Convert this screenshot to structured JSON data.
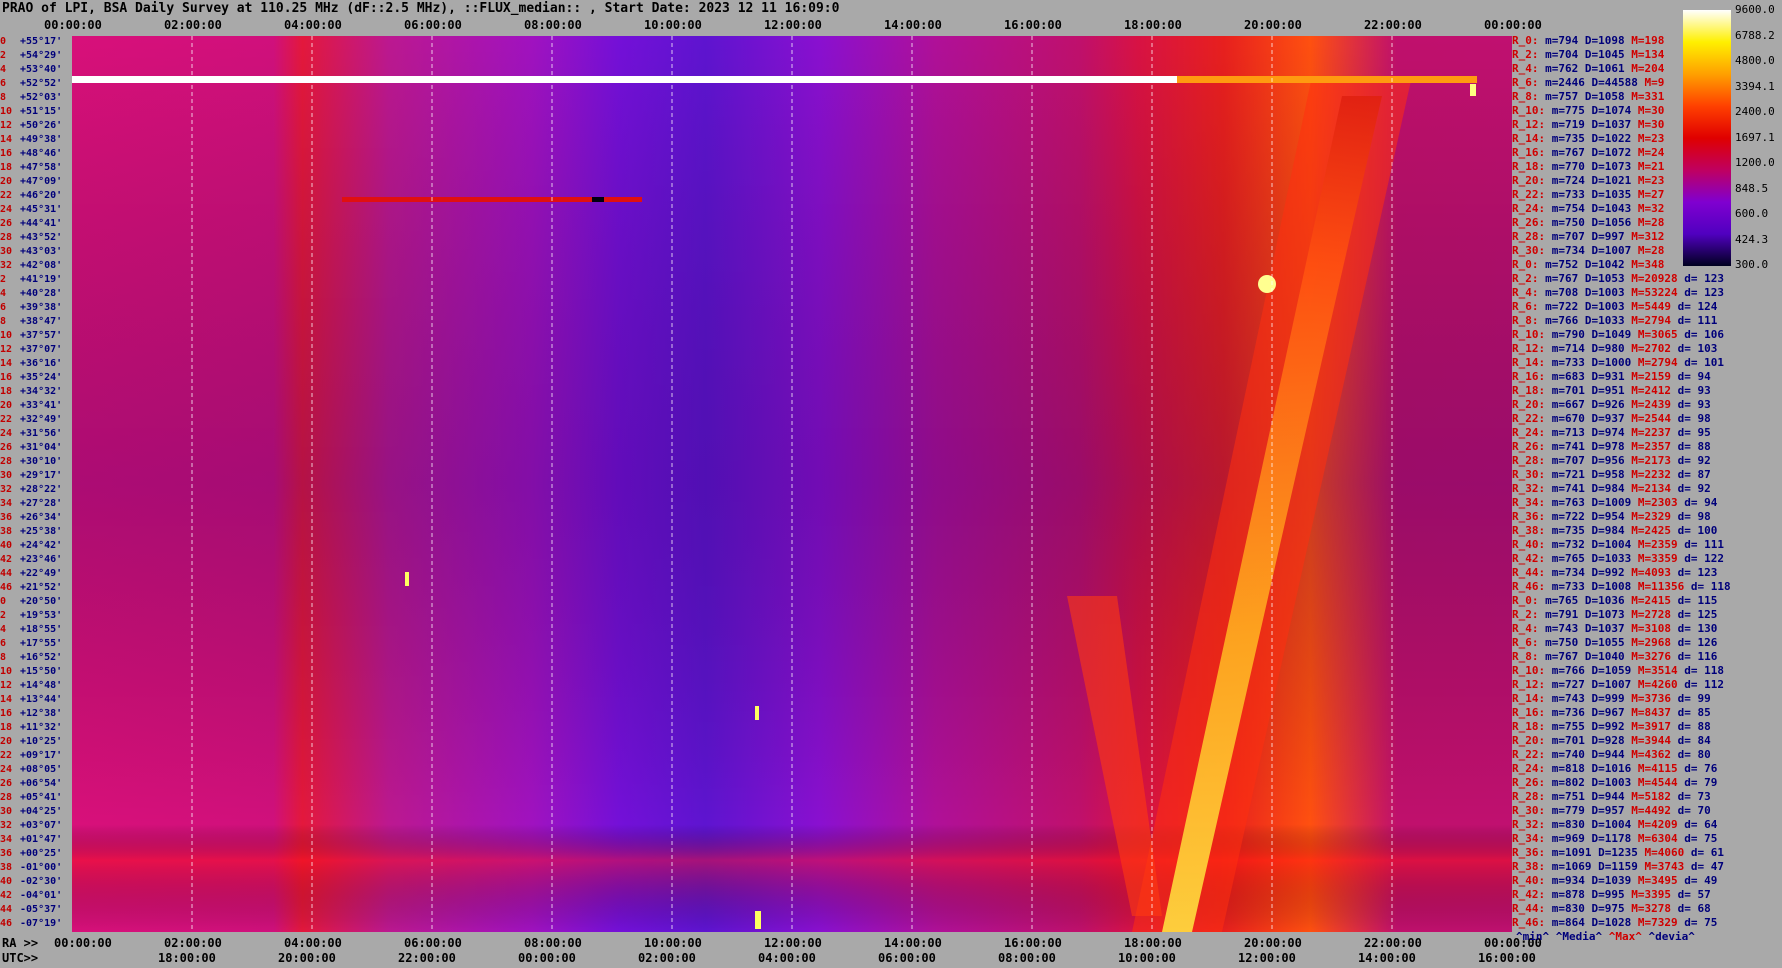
{
  "title": "PRAO of LPI, BSA Daily Survey at 110.25 MHz (dF::2.5 MHz), ::FLUX_median:: , Start Date: 2023 12 11 16:09:0",
  "top_axis_labels": [
    "00:00:00",
    "02:00:00",
    "04:00:00",
    "06:00:00",
    "08:00:00",
    "10:00:00",
    "12:00:00",
    "14:00:00",
    "16:00:00",
    "18:00:00",
    "20:00:00",
    "22:00:00",
    "00:00:00"
  ],
  "bottom_ra_prefix": "RA >>",
  "bottom_ra_labels": [
    "00:00:00",
    "02:00:00",
    "04:00:00",
    "06:00:00",
    "08:00:00",
    "10:00:00",
    "12:00:00",
    "14:00:00",
    "16:00:00",
    "18:00:00",
    "20:00:00",
    "22:00:00",
    "00:00:00"
  ],
  "bottom_utc_prefix": "UTC>>",
  "bottom_utc_labels": [
    "18:00:00",
    "20:00:00",
    "22:00:00",
    "00:00:00",
    "02:00:00",
    "04:00:00",
    "06:00:00",
    "08:00:00",
    "10:00:00",
    "12:00:00",
    "14:00:00",
    "16:00:00"
  ],
  "declinations": [
    {
      "idx": "0",
      "dec": "+55°17'"
    },
    {
      "idx": "2",
      "dec": "+54°29'"
    },
    {
      "idx": "4",
      "dec": "+53°40'"
    },
    {
      "idx": "6",
      "dec": "+52°52'"
    },
    {
      "idx": "8",
      "dec": "+52°03'"
    },
    {
      "idx": "10",
      "dec": "+51°15'"
    },
    {
      "idx": "12",
      "dec": "+50°26'"
    },
    {
      "idx": "14",
      "dec": "+49°38'"
    },
    {
      "idx": "16",
      "dec": "+48°46'"
    },
    {
      "idx": "18",
      "dec": "+47°58'"
    },
    {
      "idx": "20",
      "dec": "+47°09'"
    },
    {
      "idx": "22",
      "dec": "+46°20'"
    },
    {
      "idx": "24",
      "dec": "+45°31'"
    },
    {
      "idx": "26",
      "dec": "+44°41'"
    },
    {
      "idx": "28",
      "dec": "+43°52'"
    },
    {
      "idx": "30",
      "dec": "+43°03'"
    },
    {
      "idx": "32",
      "dec": "+42°08'"
    },
    {
      "idx": "2",
      "dec": "+41°19'"
    },
    {
      "idx": "4",
      "dec": "+40°28'"
    },
    {
      "idx": "6",
      "dec": "+39°38'"
    },
    {
      "idx": "8",
      "dec": "+38°47'"
    },
    {
      "idx": "10",
      "dec": "+37°57'"
    },
    {
      "idx": "12",
      "dec": "+37°07'"
    },
    {
      "idx": "14",
      "dec": "+36°16'"
    },
    {
      "idx": "16",
      "dec": "+35°24'"
    },
    {
      "idx": "18",
      "dec": "+34°32'"
    },
    {
      "idx": "20",
      "dec": "+33°41'"
    },
    {
      "idx": "22",
      "dec": "+32°49'"
    },
    {
      "idx": "24",
      "dec": "+31°56'"
    },
    {
      "idx": "26",
      "dec": "+31°04'"
    },
    {
      "idx": "28",
      "dec": "+30°10'"
    },
    {
      "idx": "30",
      "dec": "+29°17'"
    },
    {
      "idx": "32",
      "dec": "+28°22'"
    },
    {
      "idx": "34",
      "dec": "+27°28'"
    },
    {
      "idx": "36",
      "dec": "+26°34'"
    },
    {
      "idx": "38",
      "dec": "+25°38'"
    },
    {
      "idx": "40",
      "dec": "+24°42'"
    },
    {
      "idx": "42",
      "dec": "+23°46'"
    },
    {
      "idx": "44",
      "dec": "+22°49'"
    },
    {
      "idx": "46",
      "dec": "+21°52'"
    },
    {
      "idx": "0",
      "dec": "+20°50'"
    },
    {
      "idx": "2",
      "dec": "+19°53'"
    },
    {
      "idx": "4",
      "dec": "+18°55'"
    },
    {
      "idx": "6",
      "dec": "+17°55'"
    },
    {
      "idx": "8",
      "dec": "+16°52'"
    },
    {
      "idx": "10",
      "dec": "+15°50'"
    },
    {
      "idx": "12",
      "dec": "+14°48'"
    },
    {
      "idx": "14",
      "dec": "+13°44'"
    },
    {
      "idx": "16",
      "dec": "+12°38'"
    },
    {
      "idx": "18",
      "dec": "+11°32'"
    },
    {
      "idx": "20",
      "dec": "+10°25'"
    },
    {
      "idx": "22",
      "dec": "+09°17'"
    },
    {
      "idx": "24",
      "dec": "+08°05'"
    },
    {
      "idx": "26",
      "dec": "+06°54'"
    },
    {
      "idx": "28",
      "dec": "+05°41'"
    },
    {
      "idx": "30",
      "dec": "+04°25'"
    },
    {
      "idx": "32",
      "dec": "+03°07'"
    },
    {
      "idx": "34",
      "dec": "+01°47'"
    },
    {
      "idx": "36",
      "dec": "+00°25'"
    },
    {
      "idx": "38",
      "dec": "-01°00'"
    },
    {
      "idx": "40",
      "dec": "-02°30'"
    },
    {
      "idx": "42",
      "dec": "-04°01'"
    },
    {
      "idx": "44",
      "dec": "-05°37'"
    },
    {
      "idx": "46",
      "dec": "-07°19'"
    }
  ],
  "stats": [
    {
      "beam": "R_0:",
      "min": "m=794",
      "med": "D=1098",
      "max": "M=198",
      "dev": ""
    },
    {
      "beam": "R_2:",
      "min": "m=704",
      "med": "D=1045",
      "max": "M=134",
      "dev": ""
    },
    {
      "beam": "R_4:",
      "min": "m=762",
      "med": "D=1061",
      "max": "M=204",
      "dev": ""
    },
    {
      "beam": "R_6:",
      "min": "m=2446",
      "med": "D=44588",
      "max": "M=9",
      "dev": ""
    },
    {
      "beam": "R_8:",
      "min": "m=757",
      "med": "D=1058",
      "max": "M=331",
      "dev": ""
    },
    {
      "beam": "R_10:",
      "min": "m=775",
      "med": "D=1074",
      "max": "M=30",
      "dev": ""
    },
    {
      "beam": "R_12:",
      "min": "m=719",
      "med": "D=1037",
      "max": "M=30",
      "dev": ""
    },
    {
      "beam": "R_14:",
      "min": "m=735",
      "med": "D=1022",
      "max": "M=23",
      "dev": ""
    },
    {
      "beam": "R_16:",
      "min": "m=767",
      "med": "D=1072",
      "max": "M=24",
      "dev": ""
    },
    {
      "beam": "R_18:",
      "min": "m=770",
      "med": "D=1073",
      "max": "M=21",
      "dev": ""
    },
    {
      "beam": "R_20:",
      "min": "m=724",
      "med": "D=1021",
      "max": "M=23",
      "dev": ""
    },
    {
      "beam": "R_22:",
      "min": "m=733",
      "med": "D=1035",
      "max": "M=27",
      "dev": ""
    },
    {
      "beam": "R_24:",
      "min": "m=754",
      "med": "D=1043",
      "max": "M=32",
      "dev": ""
    },
    {
      "beam": "R_26:",
      "min": "m=750",
      "med": "D=1056",
      "max": "M=28",
      "dev": ""
    },
    {
      "beam": "R_28:",
      "min": "m=707",
      "med": "D=997",
      "max": "M=312",
      "dev": ""
    },
    {
      "beam": "R_30:",
      "min": "m=734",
      "med": "D=1007",
      "max": "M=28",
      "dev": ""
    },
    {
      "beam": "R_0:",
      "min": "m=752",
      "med": "D=1042",
      "max": "M=348",
      "dev": ""
    },
    {
      "beam": "R_2:",
      "min": "m=767",
      "med": "D=1053",
      "max": "M=20928",
      "dev": "d= 123"
    },
    {
      "beam": "R_4:",
      "min": "m=708",
      "med": "D=1003",
      "max": "M=53224",
      "dev": "d= 123"
    },
    {
      "beam": "R_6:",
      "min": "m=722",
      "med": "D=1003",
      "max": "M=5449",
      "dev": "d= 124"
    },
    {
      "beam": "R_8:",
      "min": "m=766",
      "med": "D=1033",
      "max": "M=2794",
      "dev": "d= 111"
    },
    {
      "beam": "R_10:",
      "min": "m=790",
      "med": "D=1049",
      "max": "M=3065",
      "dev": "d= 106"
    },
    {
      "beam": "R_12:",
      "min": "m=714",
      "med": "D=980",
      "max": "M=2702",
      "dev": "d= 103"
    },
    {
      "beam": "R_14:",
      "min": "m=733",
      "med": "D=1000",
      "max": "M=2794",
      "dev": "d= 101"
    },
    {
      "beam": "R_16:",
      "min": "m=683",
      "med": "D=931",
      "max": "M=2159",
      "dev": "d= 94"
    },
    {
      "beam": "R_18:",
      "min": "m=701",
      "med": "D=951",
      "max": "M=2412",
      "dev": "d= 93"
    },
    {
      "beam": "R_20:",
      "min": "m=667",
      "med": "D=926",
      "max": "M=2439",
      "dev": "d= 93"
    },
    {
      "beam": "R_22:",
      "min": "m=670",
      "med": "D=937",
      "max": "M=2544",
      "dev": "d= 98"
    },
    {
      "beam": "R_24:",
      "min": "m=713",
      "med": "D=974",
      "max": "M=2237",
      "dev": "d= 95"
    },
    {
      "beam": "R_26:",
      "min": "m=741",
      "med": "D=978",
      "max": "M=2357",
      "dev": "d= 88"
    },
    {
      "beam": "R_28:",
      "min": "m=707",
      "med": "D=956",
      "max": "M=2173",
      "dev": "d= 92"
    },
    {
      "beam": "R_30:",
      "min": "m=721",
      "med": "D=958",
      "max": "M=2232",
      "dev": "d= 87"
    },
    {
      "beam": "R_32:",
      "min": "m=741",
      "med": "D=984",
      "max": "M=2134",
      "dev": "d= 92"
    },
    {
      "beam": "R_34:",
      "min": "m=763",
      "med": "D=1009",
      "max": "M=2303",
      "dev": "d= 94"
    },
    {
      "beam": "R_36:",
      "min": "m=722",
      "med": "D=954",
      "max": "M=2329",
      "dev": "d= 98"
    },
    {
      "beam": "R_38:",
      "min": "m=735",
      "med": "D=984",
      "max": "M=2425",
      "dev": "d= 100"
    },
    {
      "beam": "R_40:",
      "min": "m=732",
      "med": "D=1004",
      "max": "M=2359",
      "dev": "d= 111"
    },
    {
      "beam": "R_42:",
      "min": "m=765",
      "med": "D=1033",
      "max": "M=3359",
      "dev": "d= 122"
    },
    {
      "beam": "R_44:",
      "min": "m=734",
      "med": "D=992",
      "max": "M=4093",
      "dev": "d= 123"
    },
    {
      "beam": "R_46:",
      "min": "m=733",
      "med": "D=1008",
      "max": "M=11356",
      "dev": "d= 118"
    },
    {
      "beam": "R_0:",
      "min": "m=765",
      "med": "D=1036",
      "max": "M=2415",
      "dev": "d= 115"
    },
    {
      "beam": "R_2:",
      "min": "m=791",
      "med": "D=1073",
      "max": "M=2728",
      "dev": "d= 125"
    },
    {
      "beam": "R_4:",
      "min": "m=743",
      "med": "D=1037",
      "max": "M=3108",
      "dev": "d= 130"
    },
    {
      "beam": "R_6:",
      "min": "m=750",
      "med": "D=1055",
      "max": "M=2968",
      "dev": "d= 126"
    },
    {
      "beam": "R_8:",
      "min": "m=767",
      "med": "D=1040",
      "max": "M=3276",
      "dev": "d= 116"
    },
    {
      "beam": "R_10:",
      "min": "m=766",
      "med": "D=1059",
      "max": "M=3514",
      "dev": "d= 118"
    },
    {
      "beam": "R_12:",
      "min": "m=727",
      "med": "D=1007",
      "max": "M=4260",
      "dev": "d= 112"
    },
    {
      "beam": "R_14:",
      "min": "m=743",
      "med": "D=999",
      "max": "M=3736",
      "dev": "d= 99"
    },
    {
      "beam": "R_16:",
      "min": "m=736",
      "med": "D=967",
      "max": "M=8437",
      "dev": "d= 85"
    },
    {
      "beam": "R_18:",
      "min": "m=755",
      "med": "D=992",
      "max": "M=3917",
      "dev": "d= 88"
    },
    {
      "beam": "R_20:",
      "min": "m=701",
      "med": "D=928",
      "max": "M=3944",
      "dev": "d= 84"
    },
    {
      "beam": "R_22:",
      "min": "m=740",
      "med": "D=944",
      "max": "M=4362",
      "dev": "d= 80"
    },
    {
      "beam": "R_24:",
      "min": "m=818",
      "med": "D=1016",
      "max": "M=4115",
      "dev": "d= 76"
    },
    {
      "beam": "R_26:",
      "min": "m=802",
      "med": "D=1003",
      "max": "M=4544",
      "dev": "d= 79"
    },
    {
      "beam": "R_28:",
      "min": "m=751",
      "med": "D=944",
      "max": "M=5182",
      "dev": "d= 73"
    },
    {
      "beam": "R_30:",
      "min": "m=779",
      "med": "D=957",
      "max": "M=4492",
      "dev": "d= 70"
    },
    {
      "beam": "R_32:",
      "min": "m=830",
      "med": "D=1004",
      "max": "M=4209",
      "dev": "d= 64"
    },
    {
      "beam": "R_34:",
      "min": "m=969",
      "med": "D=1178",
      "max": "M=6304",
      "dev": "d= 75"
    },
    {
      "beam": "R_36:",
      "min": "m=1091",
      "med": "D=1235",
      "max": "M=4060",
      "dev": "d= 61"
    },
    {
      "beam": "R_38:",
      "min": "m=1069",
      "med": "D=1159",
      "max": "M=3743",
      "dev": "d= 47"
    },
    {
      "beam": "R_40:",
      "min": "m=934",
      "med": "D=1039",
      "max": "M=3495",
      "dev": "d= 49"
    },
    {
      "beam": "R_42:",
      "min": "m=878",
      "med": "D=995",
      "max": "M=3395",
      "dev": "d= 57"
    },
    {
      "beam": "R_44:",
      "min": "m=830",
      "med": "D=975",
      "max": "M=3278",
      "dev": "d= 68"
    },
    {
      "beam": "R_46:",
      "min": "m=864",
      "med": "D=1028",
      "max": "M=7329",
      "dev": "d= 75"
    }
  ],
  "stats_footer": {
    "min": "^min^",
    "median": "^Media^",
    "max": "^Max^",
    "dev": "^devia^"
  },
  "colorbar": {
    "labels": [
      "9600.0",
      "6788.2",
      "4800.0",
      "3394.1",
      "2400.0",
      "1697.1",
      "1200.0",
      "848.5",
      "600.0",
      "424.3",
      "300.0"
    ],
    "colors": [
      "#ffffff",
      "#fff000",
      "#ffa000",
      "#ff4000",
      "#e00000",
      "#c00060",
      "#8000d0",
      "#5000c0",
      "#000020"
    ]
  },
  "chart_data": {
    "type": "heatmap",
    "title": "PRAO of LPI, BSA Daily Survey at 110.25 MHz (dF::2.5 MHz), ::FLUX_median:: , Start Date: 2023 12 11 16:09:0",
    "xlabel": "RA / UTC",
    "ylabel": "",
    "x_ticks_ra": [
      "00:00:00",
      "02:00:00",
      "04:00:00",
      "06:00:00",
      "08:00:00",
      "10:00:00",
      "12:00:00",
      "14:00:00",
      "16:00:00",
      "18:00:00",
      "20:00:00",
      "22:00:00",
      "00:00:00"
    ],
    "x_ticks_utc": [
      "18:00:00",
      "20:00:00",
      "22:00:00",
      "00:00:00",
      "02:00:00",
      "04:00:00",
      "06:00:00",
      "08:00:00",
      "10:00:00",
      "12:00:00",
      "14:00:00",
      "16:00:00"
    ],
    "y_ticks": [
      "+55°17'",
      "-07°19'"
    ],
    "colorscale_range": [
      300.0,
      9600.0
    ],
    "colorscale": "log"
  }
}
